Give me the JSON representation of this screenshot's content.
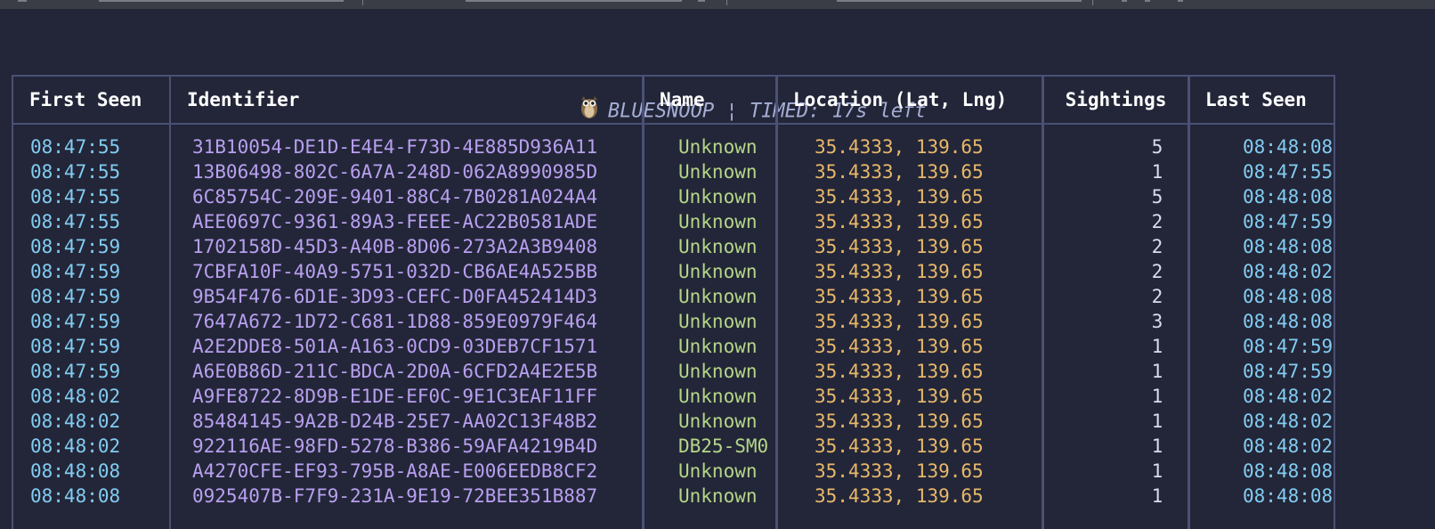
{
  "app_title": "BLUESNOOP ¦ TIMED: 17s left",
  "columns": [
    "First Seen",
    "Identifier",
    "Name",
    "Location (Lat, Lng)",
    "Sightings",
    "Last Seen"
  ],
  "rows": [
    {
      "first_seen": "08:47:55",
      "identifier": "31B10054-DE1D-E4E4-F73D-4E885D936A11",
      "name": "Unknown",
      "lat": "35.4333",
      "lng": "139.65",
      "sightings": "5",
      "last_seen": "08:48:08"
    },
    {
      "first_seen": "08:47:55",
      "identifier": "13B06498-802C-6A7A-248D-062A8990985D",
      "name": "Unknown",
      "lat": "35.4333",
      "lng": "139.65",
      "sightings": "1",
      "last_seen": "08:47:55"
    },
    {
      "first_seen": "08:47:55",
      "identifier": "6C85754C-209E-9401-88C4-7B0281A024A4",
      "name": "Unknown",
      "lat": "35.4333",
      "lng": "139.65",
      "sightings": "5",
      "last_seen": "08:48:08"
    },
    {
      "first_seen": "08:47:55",
      "identifier": "AEE0697C-9361-89A3-FEEE-AC22B0581ADE",
      "name": "Unknown",
      "lat": "35.4333",
      "lng": "139.65",
      "sightings": "2",
      "last_seen": "08:47:59"
    },
    {
      "first_seen": "08:47:59",
      "identifier": "1702158D-45D3-A40B-8D06-273A2A3B9408",
      "name": "Unknown",
      "lat": "35.4333",
      "lng": "139.65",
      "sightings": "2",
      "last_seen": "08:48:08"
    },
    {
      "first_seen": "08:47:59",
      "identifier": "7CBFA10F-40A9-5751-032D-CB6AE4A525BB",
      "name": "Unknown",
      "lat": "35.4333",
      "lng": "139.65",
      "sightings": "2",
      "last_seen": "08:48:02"
    },
    {
      "first_seen": "08:47:59",
      "identifier": "9B54F476-6D1E-3D93-CEFC-D0FA452414D3",
      "name": "Unknown",
      "lat": "35.4333",
      "lng": "139.65",
      "sightings": "2",
      "last_seen": "08:48:08"
    },
    {
      "first_seen": "08:47:59",
      "identifier": "7647A672-1D72-C681-1D88-859E0979F464",
      "name": "Unknown",
      "lat": "35.4333",
      "lng": "139.65",
      "sightings": "3",
      "last_seen": "08:48:08"
    },
    {
      "first_seen": "08:47:59",
      "identifier": "A2E2DDE8-501A-A163-0CD9-03DEB7CF1571",
      "name": "Unknown",
      "lat": "35.4333",
      "lng": "139.65",
      "sightings": "1",
      "last_seen": "08:47:59"
    },
    {
      "first_seen": "08:47:59",
      "identifier": "A6E0B86D-211C-BDCA-2D0A-6CFD2A4E2E5B",
      "name": "Unknown",
      "lat": "35.4333",
      "lng": "139.65",
      "sightings": "1",
      "last_seen": "08:47:59"
    },
    {
      "first_seen": "08:48:02",
      "identifier": "A9FE8722-8D9B-E1DE-EF0C-9E1C3EAF11FF",
      "name": "Unknown",
      "lat": "35.4333",
      "lng": "139.65",
      "sightings": "1",
      "last_seen": "08:48:02"
    },
    {
      "first_seen": "08:48:02",
      "identifier": "85484145-9A2B-D24B-25E7-AA02C13F48B2",
      "name": "Unknown",
      "lat": "35.4333",
      "lng": "139.65",
      "sightings": "1",
      "last_seen": "08:48:02"
    },
    {
      "first_seen": "08:48:02",
      "identifier": "922116AE-98FD-5278-B386-59AFA4219B4D",
      "name": "DB25-SM0",
      "lat": "35.4333",
      "lng": "139.65",
      "sightings": "1",
      "last_seen": "08:48:02"
    },
    {
      "first_seen": "08:48:08",
      "identifier": "A4270CFE-EF93-795B-A8AE-E006EEDB8CF2",
      "name": "Unknown",
      "lat": "35.4333",
      "lng": "139.65",
      "sightings": "1",
      "last_seen": "08:48:08"
    },
    {
      "first_seen": "08:48:08",
      "identifier": "0925407B-F7F9-231A-9E19-72BEE351B887",
      "name": "Unknown",
      "lat": "35.4333",
      "lng": "139.65",
      "sightings": "1",
      "last_seen": "08:48:08"
    }
  ],
  "colors": {
    "background": "#232638",
    "time": "#82ccf2",
    "identifier": "#b8a0f0",
    "name": "#b4d688",
    "location": "#e8b86a",
    "sightings": "#d8dcec",
    "border": "#4b5075",
    "title": "#a6aed4"
  },
  "icons": {
    "title_icon": "owl-icon"
  }
}
